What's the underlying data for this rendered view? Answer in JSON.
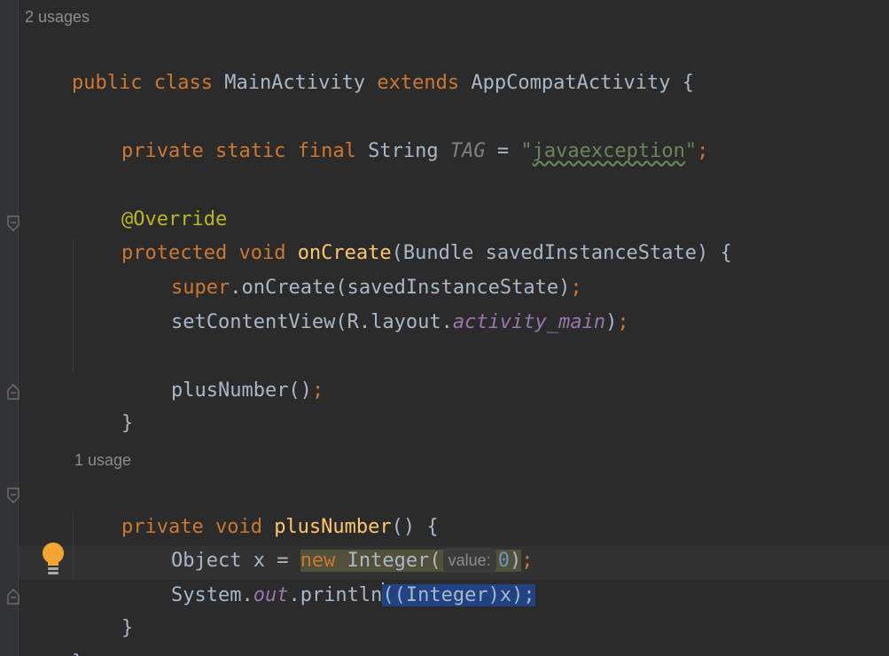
{
  "hints": {
    "class_usages": "2 usages",
    "method_usages": "1 usage",
    "param_hint": "value:"
  },
  "code": {
    "l1": {
      "kw1": "public",
      "kw2": "class",
      "name": "MainActivity",
      "kw3": "extends",
      "parent": "AppCompatActivity",
      "brace": "{"
    },
    "l2": {
      "kw1": "private",
      "kw2": "static",
      "kw3": "final",
      "type": "String",
      "field": "TAG",
      "eq": "=",
      "q1": "\"",
      "strval": "javaexception",
      "q2": "\"",
      "semi": ";"
    },
    "l3": {
      "ann": "@Override"
    },
    "l4": {
      "kw1": "protected",
      "kw2": "void",
      "fn": "onCreate",
      "params": "(Bundle savedInstanceState) {"
    },
    "l5": {
      "kw": "super",
      "rest": ".onCreate(savedInstanceState)",
      "semi": ";"
    },
    "l6": {
      "pre": "setContentView(R.layout.",
      "const": "activity_main",
      "post": ")",
      "semi": ";"
    },
    "l7": {
      "call": "plusNumber()",
      "semi": ";"
    },
    "l8": {
      "brace": "}"
    },
    "l9": {
      "kw1": "private",
      "kw2": "void",
      "fn": "plusNumber",
      "rest": "() {"
    },
    "l10": {
      "pre": "Object x = ",
      "kw": "new",
      "cls": " Integer(",
      "num": "0",
      "close": ")",
      "semi": ";"
    },
    "l11": {
      "pre": "System.",
      "field": "out",
      "mid": ".println",
      "sel": "((Integer)x);"
    },
    "l12": {
      "brace": "}"
    },
    "l13": {
      "brace": "}"
    }
  },
  "colors": {
    "background": "#2b2b2b",
    "keyword": "#cc7832",
    "function": "#ffc66d",
    "annotation": "#bbb529",
    "string": "#6a8759",
    "constant": "#9876aa",
    "number": "#6897bb",
    "selection": "#214283"
  },
  "icons": {
    "gutter_folds": [
      "fold-start-icon",
      "fold-end-icon"
    ],
    "intention": "lightbulb-icon"
  }
}
